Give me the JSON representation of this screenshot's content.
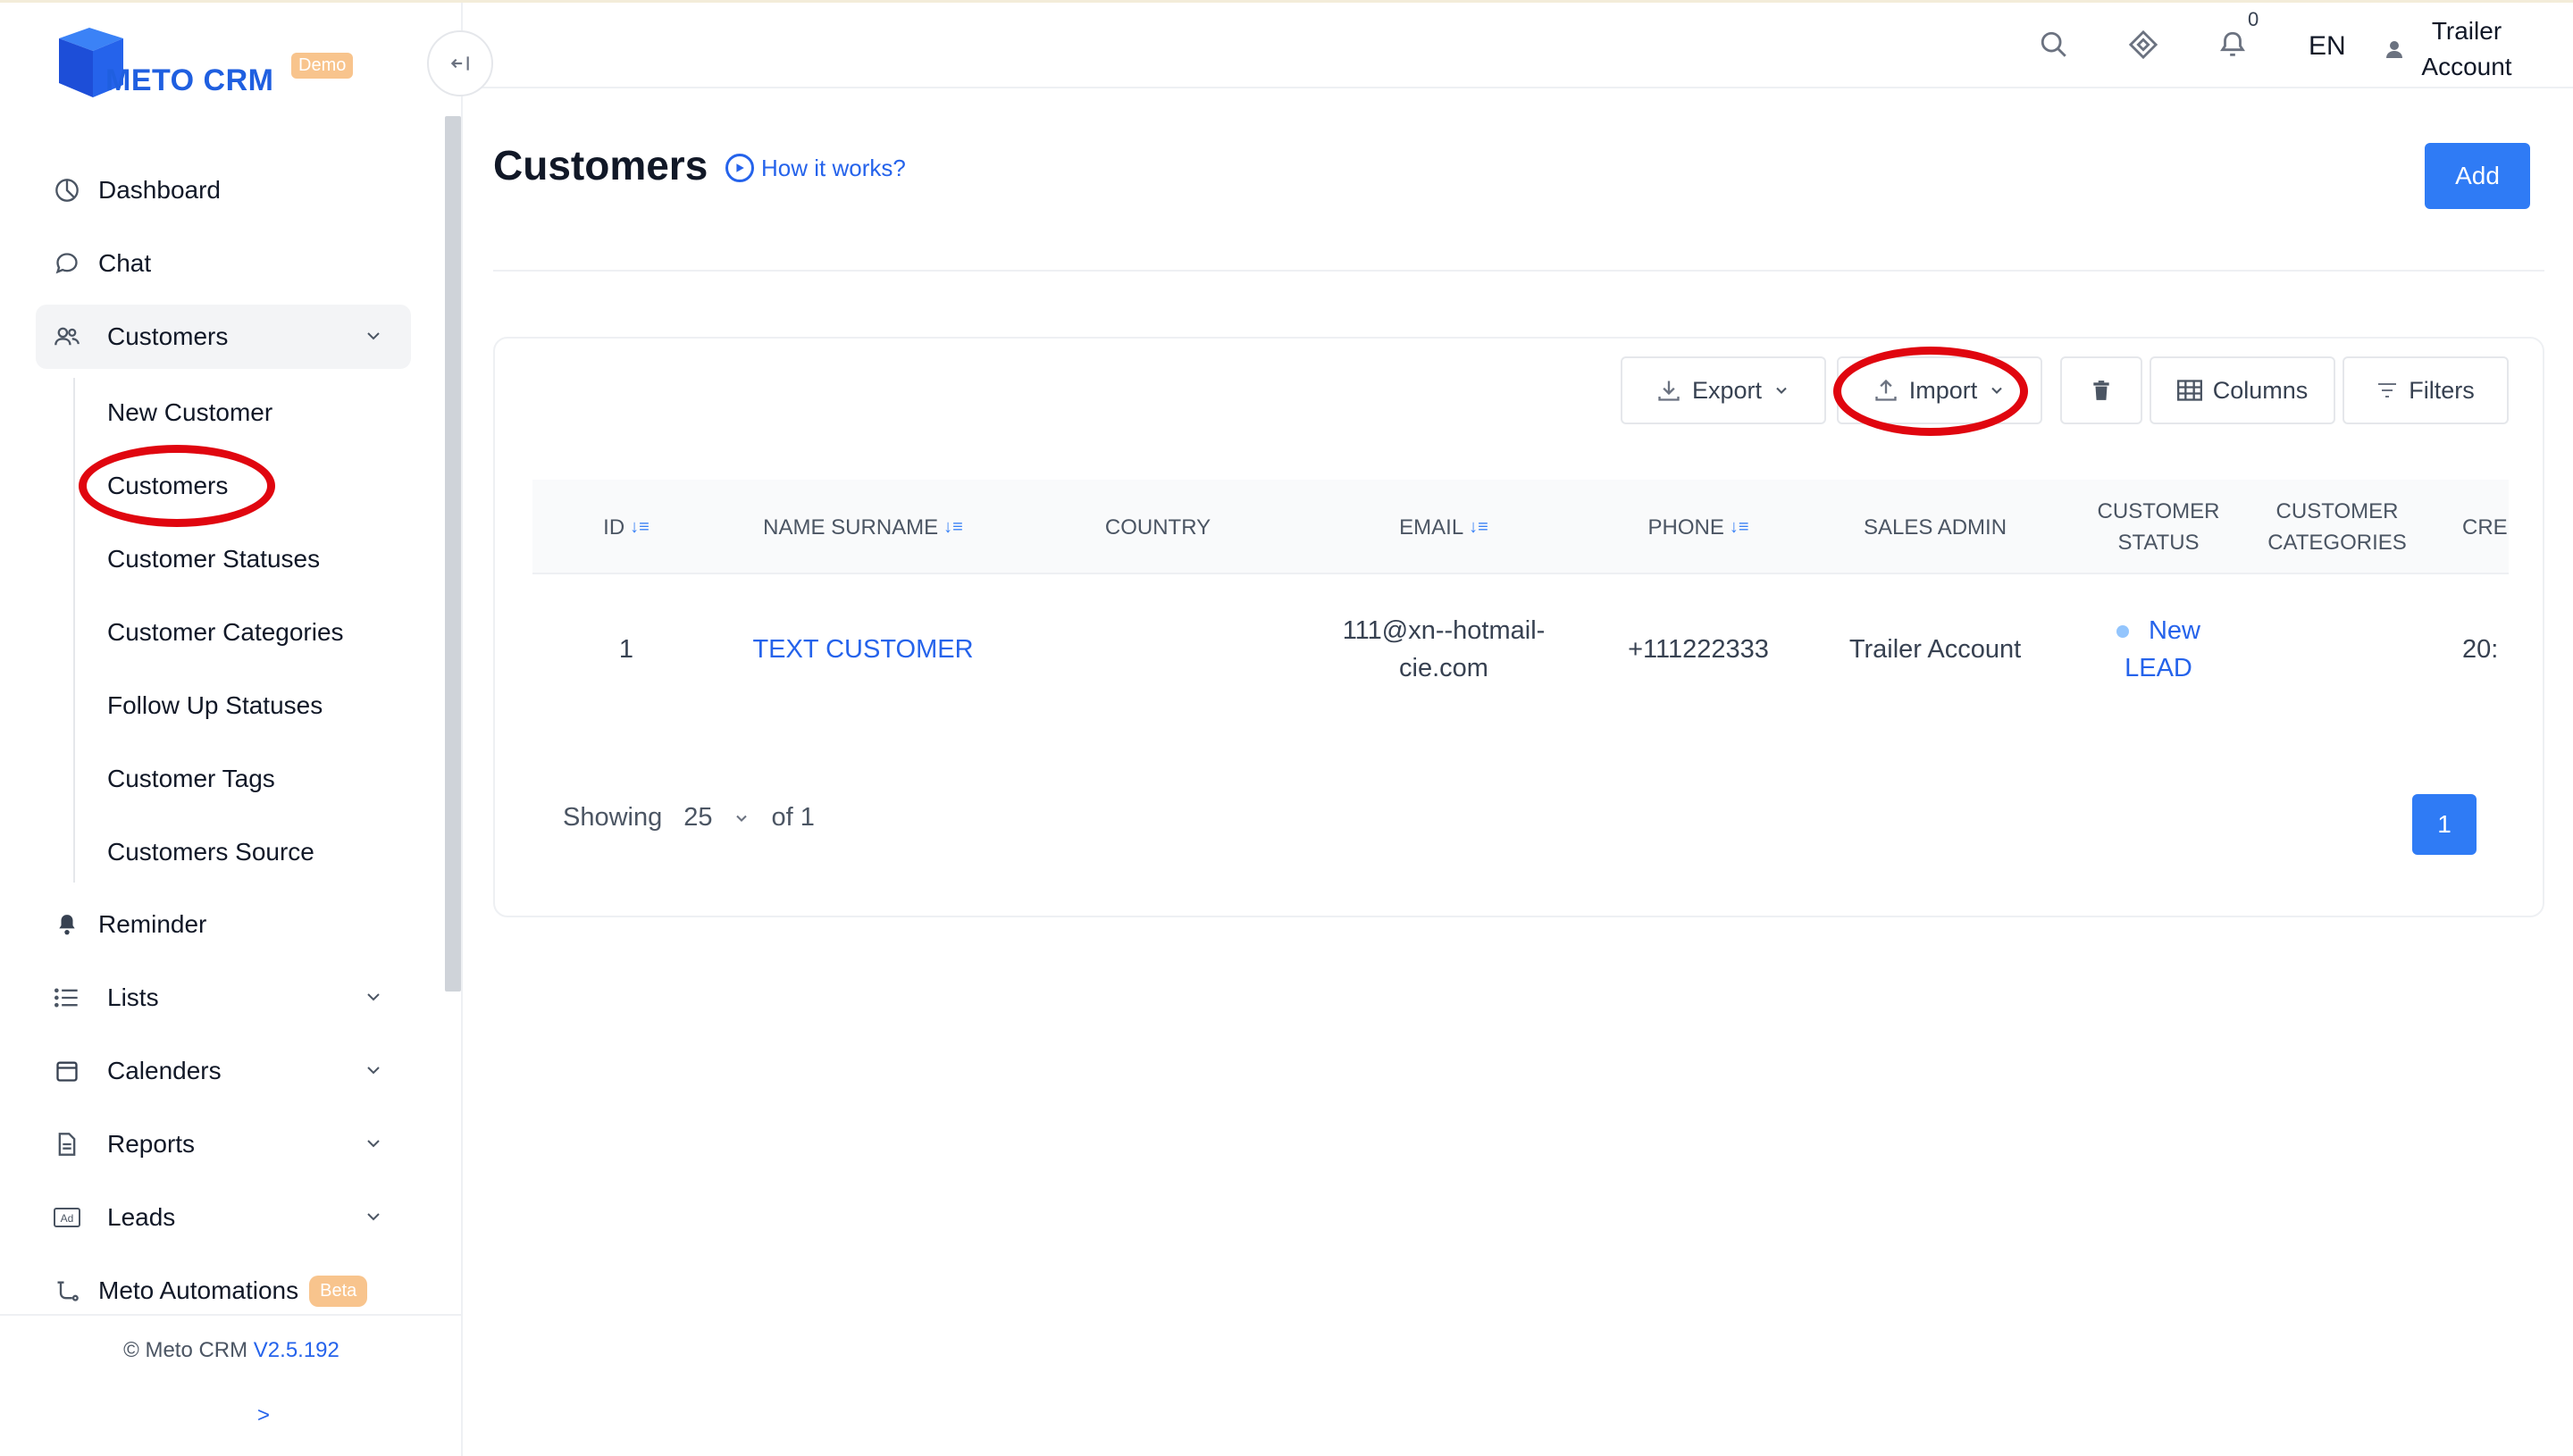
{
  "app": {
    "logo_text": "METO CRM",
    "logo_badge": "Demo",
    "brand_color": "#1f5fe0",
    "accent_color": "#2f7bf5"
  },
  "header": {
    "notification_count": "0",
    "language": "EN",
    "user_line1": "Trailer",
    "user_line2": "Account"
  },
  "sidebar": {
    "items": [
      {
        "label": "Dashboard",
        "icon": "pie-chart-icon"
      },
      {
        "label": "Chat",
        "icon": "chat-bubble-icon"
      },
      {
        "label": "Customers",
        "icon": "users-icon"
      }
    ],
    "customers_submenu": [
      "New Customer",
      "Customers",
      "Customer Statuses",
      "Customer Categories",
      "Follow Up Statuses",
      "Customer Tags",
      "Customers Source"
    ],
    "items_after": [
      {
        "label": "Reminder",
        "icon": "bell-icon"
      },
      {
        "label": "Lists",
        "icon": "list-icon"
      },
      {
        "label": "Calenders",
        "icon": "calendar-icon"
      },
      {
        "label": "Reports",
        "icon": "document-icon"
      },
      {
        "label": "Leads",
        "icon": "ad-icon"
      },
      {
        "label": "Meto Automations",
        "icon": "flow-icon",
        "badge": "Beta"
      }
    ],
    "copyright": "© Meto CRM",
    "version": "V2.5.192",
    "expand": ">"
  },
  "page": {
    "title": "Customers",
    "how_it_works": "How it works?",
    "add_button": "Add"
  },
  "toolbar": {
    "export": "Export",
    "import": "Import",
    "columns": "Columns",
    "filters": "Filters"
  },
  "table": {
    "headers": {
      "id": "ID",
      "name": "NAME SURNAME",
      "country": "COUNTRY",
      "email": "EMAIL",
      "phone": "PHONE",
      "sales_admin": "SALES ADMIN",
      "status_1": "CUSTOMER",
      "status_2": "STATUS",
      "categories_1": "CUSTOMER",
      "categories_2": "CATEGORIES",
      "created": "CRE"
    },
    "rows": [
      {
        "id": "1",
        "name": "TEXT CUSTOMER",
        "country": "",
        "email_1": "111@xn--hotmail-",
        "email_2": "cie.com",
        "phone": "+111222333",
        "sales_admin": "Trailer Account",
        "status_1": "New",
        "status_2": "LEAD",
        "categories": "",
        "created": "20:"
      }
    ]
  },
  "pagination": {
    "showing": "Showing",
    "page_size": "25",
    "of_text": "of 1",
    "current_page": "1"
  },
  "annotations": {
    "highlight_color": "#e0060f"
  }
}
